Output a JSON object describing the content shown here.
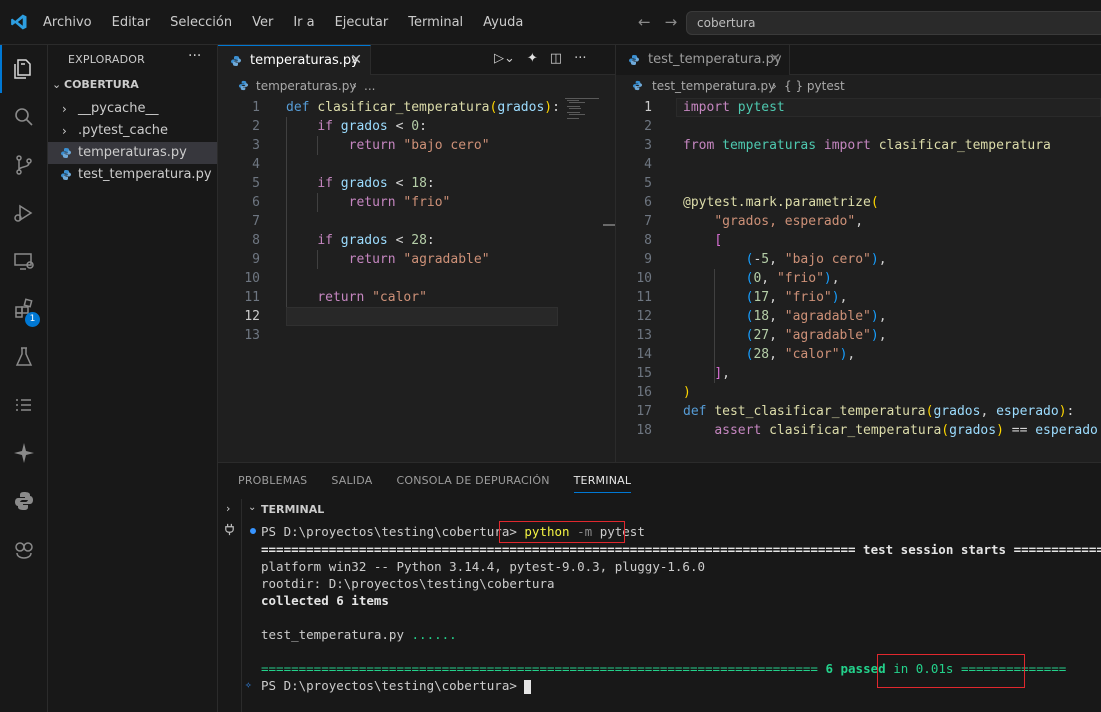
{
  "menu": [
    "Archivo",
    "Editar",
    "Selección",
    "Ver",
    "Ir a",
    "Ejecutar",
    "Terminal",
    "Ayuda"
  ],
  "search": {
    "text": "cobertura"
  },
  "activity_badge": "1",
  "sidebar": {
    "title": "EXPLORADOR",
    "folder": "COBERTURA",
    "items": [
      {
        "label": "__pycache__"
      },
      {
        "label": ".pytest_cache"
      },
      {
        "label": "temperaturas.py"
      },
      {
        "label": "test_temperatura.py"
      }
    ]
  },
  "left_editor": {
    "tab": "temperaturas.py",
    "breadcrumb": "temperaturas.py",
    "breadcrumb_tail": "...",
    "line_numbers": [
      "1",
      "2",
      "3",
      "4",
      "5",
      "6",
      "7",
      "8",
      "9",
      "10",
      "11",
      "12",
      "13"
    ]
  },
  "right_editor": {
    "tab": "test_temperatura.py",
    "breadcrumb": "test_temperatura.py",
    "breadcrumb_tail": "{ } pytest",
    "line_numbers": [
      "1",
      "2",
      "3",
      "4",
      "5",
      "6",
      "7",
      "8",
      "9",
      "10",
      "11",
      "12",
      "13",
      "14",
      "15",
      "16",
      "17",
      "18"
    ]
  },
  "panel": {
    "tabs": [
      "PROBLEMAS",
      "SALIDA",
      "CONSOLA DE DEPURACIÓN",
      "TERMINAL"
    ],
    "terminal_header": "TERMINAL",
    "prompt": "PS D:\\proyectos\\testing\\cobertura>",
    "command": "python",
    "command_flag": "-m",
    "command_arg": "pytest",
    "session_start": "=============================================================================== test session starts ============",
    "platform": "platform win32 -- Python 3.14.4, pytest-9.0.3, pluggy-1.6.0",
    "rootdir": "rootdir: D:\\proyectos\\testing\\cobertura",
    "collected": "collected 6 items",
    "test_file": "test_temperatura.py",
    "test_dots": "......",
    "result_sep_left": "==========================================================================",
    "passed": "6 passed",
    "passed_time": "in 0.01s",
    "result_sep_right": "=============="
  }
}
